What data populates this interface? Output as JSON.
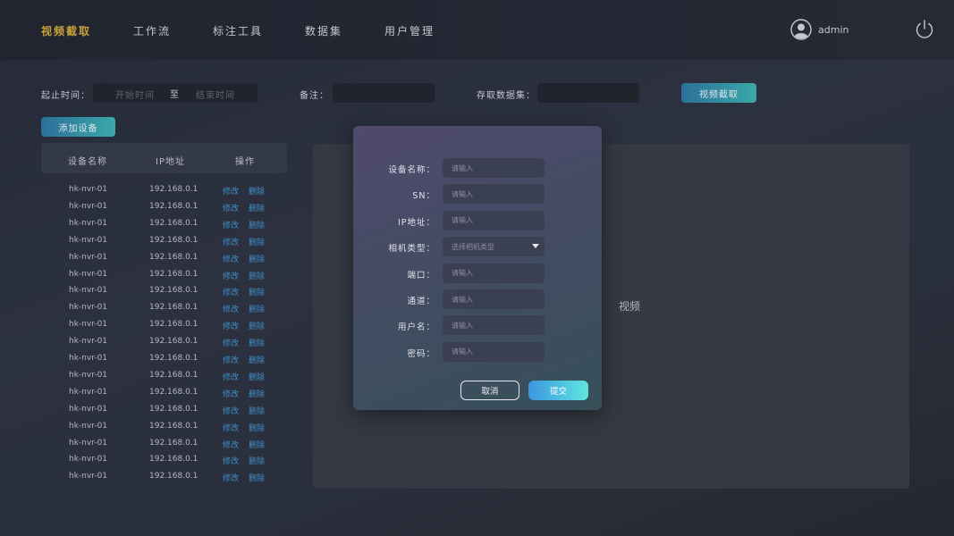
{
  "nav": {
    "items": [
      {
        "label": "视频截取",
        "active": true
      },
      {
        "label": "工作流",
        "active": false
      },
      {
        "label": "标注工具",
        "active": false
      },
      {
        "label": "数据集",
        "active": false
      },
      {
        "label": "用户管理",
        "active": false
      }
    ],
    "user_name": "admin",
    "active_color": "#c9a13a"
  },
  "filters": {
    "time_label": "起止时间：",
    "start_placeholder": "开始时间",
    "separator": "至",
    "end_placeholder": "结束时间",
    "note_label": "备注：",
    "dataset_label": "存取数据集：",
    "capture_button": "视频截取"
  },
  "device_table": {
    "add_button": "添加设备",
    "headers": [
      "设备名称",
      "IP地址",
      "操作"
    ],
    "rows": [
      {
        "name": "hk-nvr-01",
        "ip": "192.168.0.1"
      },
      {
        "name": "hk-nvr-01",
        "ip": "192.168.0.1"
      },
      {
        "name": "hk-nvr-01",
        "ip": "192.168.0.1"
      },
      {
        "name": "hk-nvr-01",
        "ip": "192.168.0.1"
      },
      {
        "name": "hk-nvr-01",
        "ip": "192.168.0.1"
      },
      {
        "name": "hk-nvr-01",
        "ip": "192.168.0.1"
      },
      {
        "name": "hk-nvr-01",
        "ip": "192.168.0.1"
      },
      {
        "name": "hk-nvr-01",
        "ip": "192.168.0.1"
      },
      {
        "name": "hk-nvr-01",
        "ip": "192.168.0.1"
      },
      {
        "name": "hk-nvr-01",
        "ip": "192.168.0.1"
      },
      {
        "name": "hk-nvr-01",
        "ip": "192.168.0.1"
      },
      {
        "name": "hk-nvr-01",
        "ip": "192.168.0.1"
      },
      {
        "name": "hk-nvr-01",
        "ip": "192.168.0.1"
      },
      {
        "name": "hk-nvr-01",
        "ip": "192.168.0.1"
      },
      {
        "name": "hk-nvr-01",
        "ip": "192.168.0.1"
      },
      {
        "name": "hk-nvr-01",
        "ip": "192.168.0.1"
      },
      {
        "name": "hk-nvr-01",
        "ip": "192.168.0.1"
      },
      {
        "name": "hk-nvr-01",
        "ip": "192.168.0.1"
      }
    ],
    "edit_label": "修改",
    "delete_label": "删除",
    "link_color": "#3f8fc8"
  },
  "video": {
    "label": "视频"
  },
  "modal": {
    "fields": [
      {
        "label": "设备名称：",
        "placeholder": "请输入",
        "type": "input"
      },
      {
        "label": "SN：",
        "placeholder": "请输入",
        "type": "input"
      },
      {
        "label": "IP地址：",
        "placeholder": "请输入",
        "type": "input"
      },
      {
        "label": "相机类型：",
        "placeholder": "选择相机类型",
        "type": "select"
      },
      {
        "label": "端口：",
        "placeholder": "请输入",
        "type": "input"
      },
      {
        "label": "通道：",
        "placeholder": "请输入",
        "type": "input"
      },
      {
        "label": "用户名：",
        "placeholder": "请输入",
        "type": "input"
      },
      {
        "label": "密码：",
        "placeholder": "请输入",
        "type": "input"
      }
    ],
    "cancel_label": "取消",
    "submit_label": "提交"
  }
}
